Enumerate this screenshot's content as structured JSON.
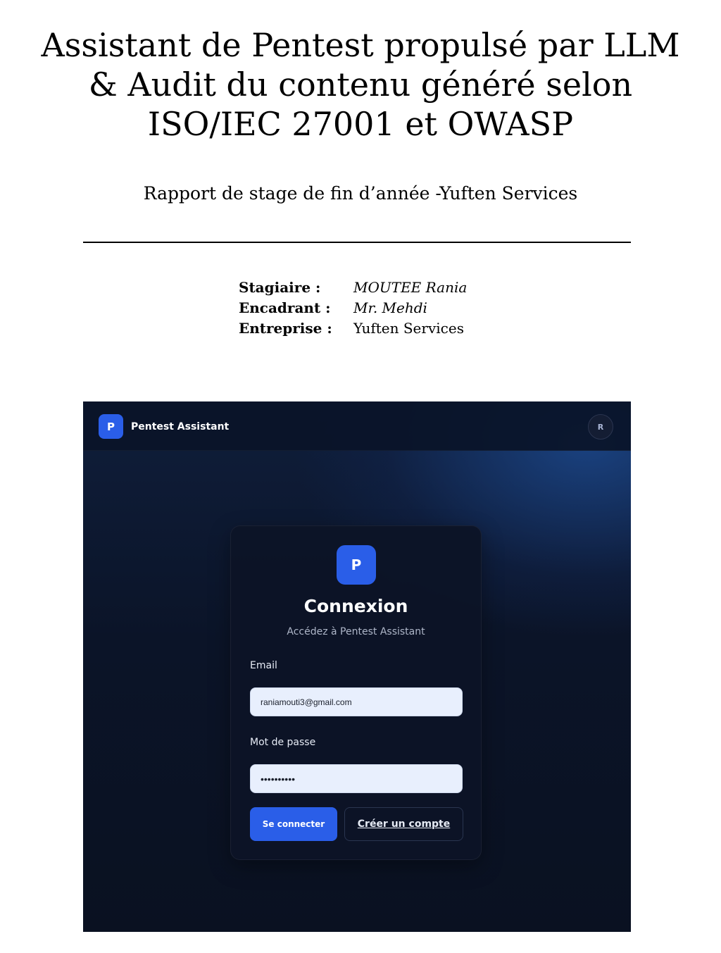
{
  "document": {
    "title_lines": [
      "Assistant de Pentest propulsé par LLM",
      "& Audit du contenu généré selon",
      "ISO/IEC 27001 et OWASP"
    ],
    "subtitle": "Rapport de stage de fin d’année -Yuften Services",
    "meta": [
      {
        "label": "Stagiaire :",
        "value": "MOUTEE Rania"
      },
      {
        "label": "Encadrant :",
        "value": "Mr. Mehdi"
      },
      {
        "label": "Entreprise :",
        "value": "Yuften Services"
      }
    ]
  },
  "app": {
    "brand": {
      "logo_letter": "P",
      "name": "Pentest Assistant"
    },
    "avatar_letter": "R",
    "login": {
      "logo_letter": "P",
      "title": "Connexion",
      "subtitle": "Accédez à Pentest Assistant",
      "email_label": "Email",
      "email_value": "raniamouti3@gmail.com",
      "password_label": "Mot de passe",
      "password_value": "••••••••••",
      "submit_label": "Se connecter",
      "register_label": "Créer un compte"
    },
    "colors": {
      "accent": "#2a5ee8",
      "background": "#0b1428",
      "card": "#0d1426",
      "input_bg": "#e8effd"
    }
  }
}
